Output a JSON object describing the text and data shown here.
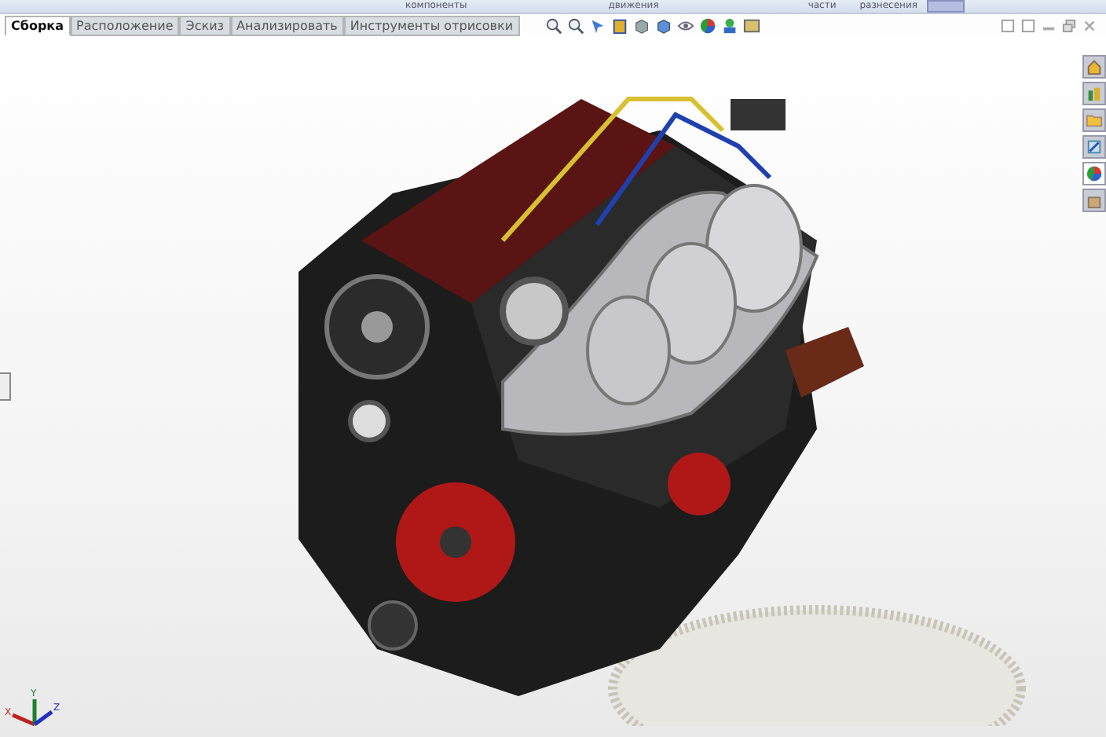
{
  "ribbon_labels": [
    "компоненты",
    "движения",
    "части",
    "разнесения"
  ],
  "tabs": [
    {
      "label": "Сборка",
      "selected": true
    },
    {
      "label": "Расположение",
      "selected": false
    },
    {
      "label": "Эскиз",
      "selected": false
    },
    {
      "label": "Анализировать",
      "selected": false
    },
    {
      "label": "Инструменты отрисовки",
      "selected": false
    }
  ],
  "triad": {
    "x": "X",
    "y": "Y",
    "z": "Z"
  }
}
